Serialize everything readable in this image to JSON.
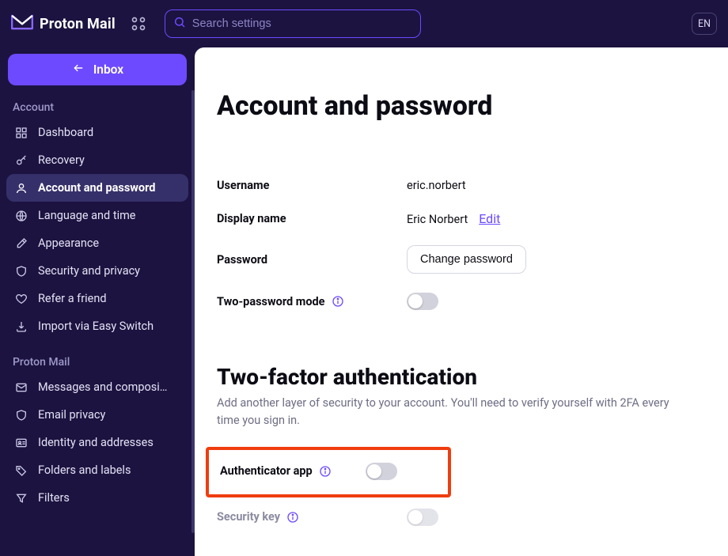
{
  "brand": {
    "name": "Proton Mail"
  },
  "search": {
    "placeholder": "Search settings"
  },
  "header": {
    "lang": "EN"
  },
  "sidebar": {
    "back_label": "Inbox",
    "section_account": "Account",
    "account_items": {
      "dashboard": "Dashboard",
      "recovery": "Recovery",
      "account_password": "Account and password",
      "language_time": "Language and time",
      "appearance": "Appearance",
      "security_privacy": "Security and privacy",
      "refer": "Refer a friend",
      "import": "Import via Easy Switch"
    },
    "section_mail": "Proton Mail",
    "mail_items": {
      "messages": "Messages and composi…",
      "email_privacy": "Email privacy",
      "identity": "Identity and addresses",
      "folders": "Folders and labels",
      "filters": "Filters"
    }
  },
  "main": {
    "title": "Account and password",
    "username_label": "Username",
    "username_value": "eric.norbert",
    "display_name_label": "Display name",
    "display_name_value": "Eric Norbert",
    "edit_label": "Edit",
    "password_label": "Password",
    "change_password_label": "Change password",
    "two_password_label": "Two-password mode",
    "tfa_title": "Two-factor authentication",
    "tfa_sub": "Add another layer of security to your account. You'll need to verify yourself with 2FA every time you sign in.",
    "authenticator_label": "Authenticator app",
    "security_key_label": "Security key"
  }
}
